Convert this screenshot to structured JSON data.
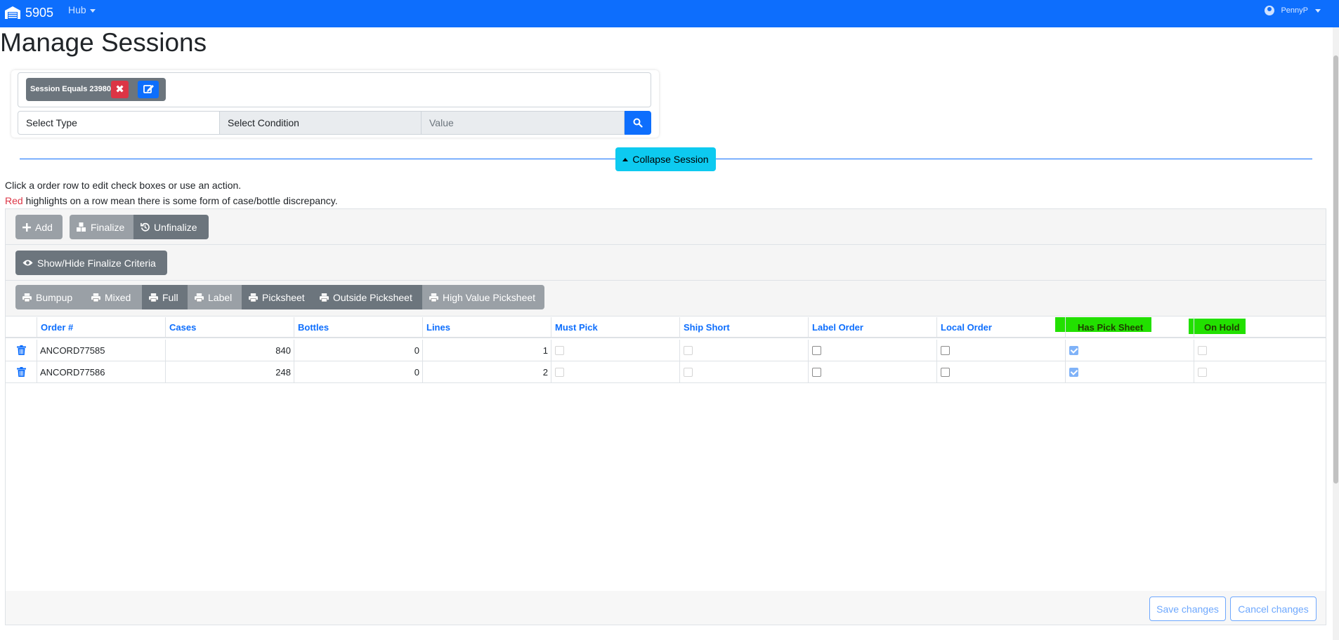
{
  "navbar": {
    "brand_number": "5905",
    "hub_label": "Hub",
    "user_name": "PennyP"
  },
  "page_title": "Manage Sessions",
  "filter": {
    "chip_label": "Session Equals 23980",
    "select_type": "Select Type",
    "select_condition": "Select Condition",
    "value_placeholder": "Value"
  },
  "collapse_label": "Collapse Session",
  "help": {
    "line1": "Click a order row to edit check boxes or use an action.",
    "line2_red": "Red",
    "line2_rest": " highlights on a row mean there is some form of case/bottle discrepancy."
  },
  "toolbar": {
    "add": "Add",
    "finalize": "Finalize",
    "unfinalize": "Unfinalize",
    "show_hide": "Show/Hide Finalize Criteria"
  },
  "print_buttons": [
    "Bumpup",
    "Mixed",
    "Full",
    "Label",
    "Picksheet",
    "Outside Picksheet",
    "High Value Picksheet"
  ],
  "table": {
    "headers": [
      "Order #",
      "Cases",
      "Bottles",
      "Lines",
      "Must Pick",
      "Ship Short",
      "Label Order",
      "Local Order",
      "Has Pick Sheet",
      "On Hold"
    ],
    "rows": [
      {
        "order": "ANCORD77585",
        "cases": "840",
        "bottles": "0",
        "lines": "1",
        "must_pick": false,
        "ship_short": false,
        "label_order": false,
        "local_order": false,
        "has_pick_sheet": true,
        "on_hold": false
      },
      {
        "order": "ANCORD77586",
        "cases": "248",
        "bottles": "0",
        "lines": "2",
        "must_pick": false,
        "ship_short": false,
        "label_order": false,
        "local_order": false,
        "has_pick_sheet": true,
        "on_hold": false
      }
    ]
  },
  "footer": {
    "save": "Save changes",
    "cancel": "Cancel changes"
  },
  "colors": {
    "primary": "#0d6efd",
    "info": "#0dcaf0",
    "danger": "#dc3545",
    "secondary": "#6c757d",
    "highlight": "#22e000"
  }
}
